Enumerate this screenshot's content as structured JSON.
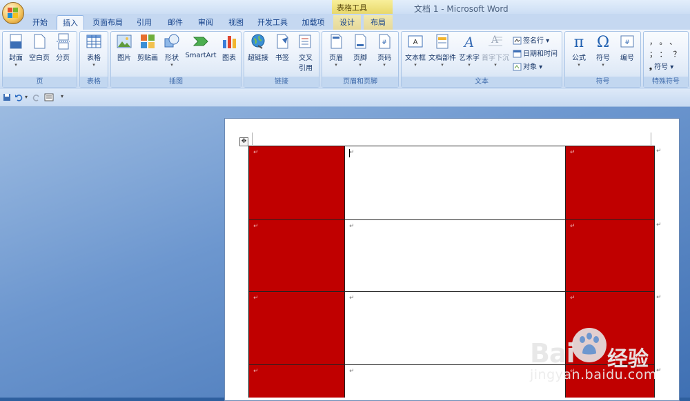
{
  "window": {
    "title": "文档 1 - Microsoft Word",
    "context_tab_group": "表格工具"
  },
  "tabs": [
    {
      "label": "开始"
    },
    {
      "label": "插入"
    },
    {
      "label": "页面布局"
    },
    {
      "label": "引用"
    },
    {
      "label": "邮件"
    },
    {
      "label": "审阅"
    },
    {
      "label": "视图"
    },
    {
      "label": "开发工具"
    },
    {
      "label": "加载项"
    },
    {
      "label": "设计"
    },
    {
      "label": "布局"
    }
  ],
  "active_tab": "插入",
  "ribbon": {
    "pages": {
      "label": "页",
      "cover": "封面",
      "blank": "空白页",
      "break": "分页"
    },
    "tables": {
      "label": "表格",
      "table": "表格"
    },
    "illustrations": {
      "label": "插图",
      "picture": "图片",
      "clipart": "剪贴画",
      "shapes": "形状",
      "smartart": "SmartArt",
      "chart": "图表"
    },
    "links": {
      "label": "链接",
      "hyperlink": "超链接",
      "bookmark": "书签",
      "crossref_1": "交叉",
      "crossref_2": "引用"
    },
    "headerfooter": {
      "label": "页眉和页脚",
      "header": "页眉",
      "footer": "页脚",
      "pagenum": "页码"
    },
    "text": {
      "label": "文本",
      "textbox": "文本框",
      "quickparts": "文档部件",
      "wordart": "艺术字",
      "dropcap": "首字下沉",
      "signature": "签名行",
      "datetime": "日期和时间",
      "object": "对象"
    },
    "symbols": {
      "label": "符号",
      "equation": "公式",
      "symbol": "符号",
      "numbering": "编号"
    },
    "special": {
      "label": "特殊符号",
      "row1": "，。、",
      "row2": "；：？",
      "symbol": "符号"
    }
  },
  "colors": {
    "red_cell": "#c00000",
    "ribbon_text": "#15428b"
  },
  "table": {
    "rows": 4,
    "columns": 3,
    "cell_mark": "↵",
    "shaded_columns": [
      0,
      2
    ]
  },
  "watermark": {
    "brand_1": "Bai",
    "brand_2": "经验",
    "url": "jingyan.baidu.com"
  }
}
